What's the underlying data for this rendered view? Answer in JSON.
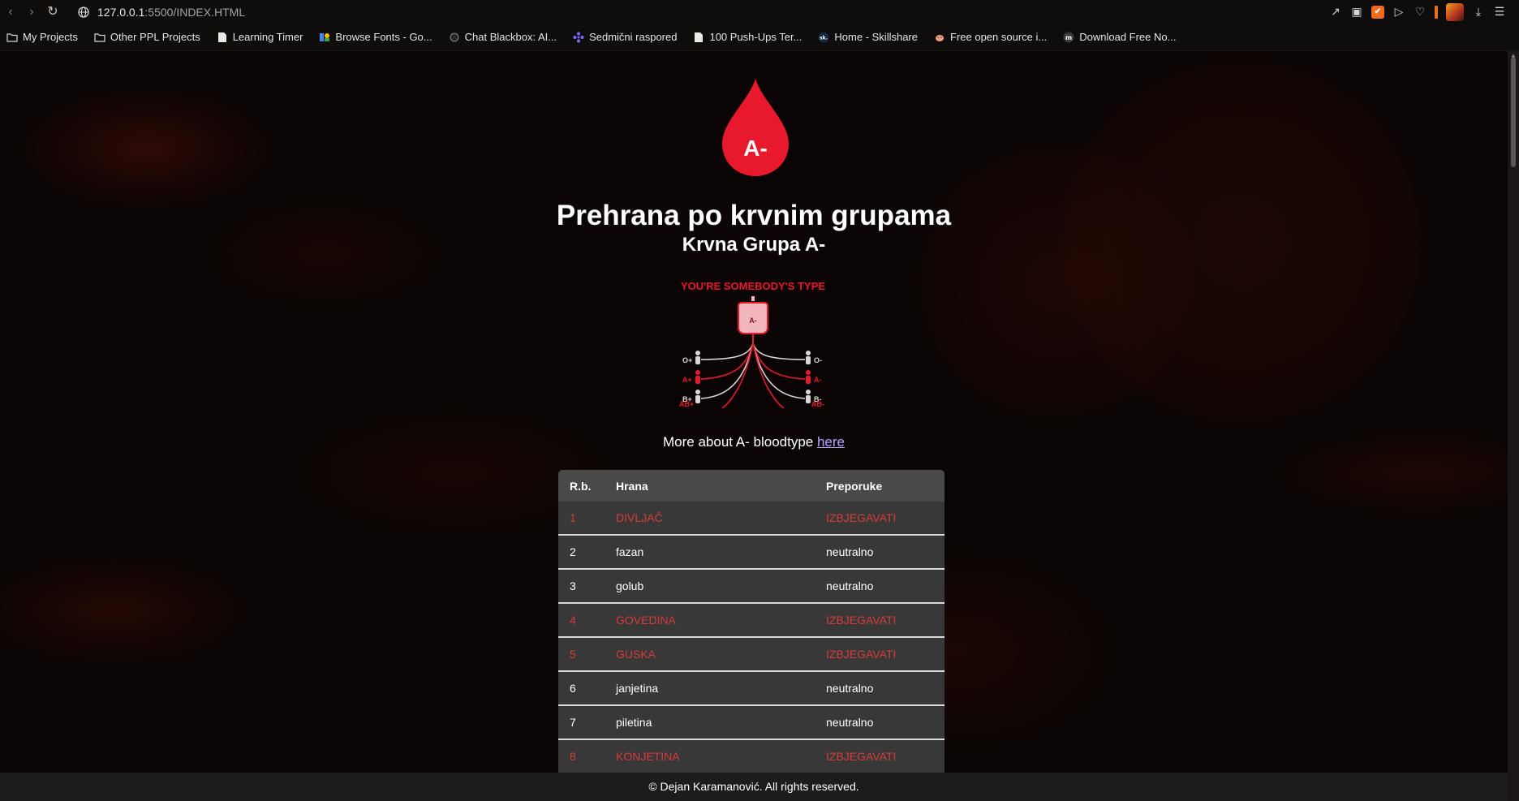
{
  "browser": {
    "url_host": "127.0.0.1",
    "url_rest": ":5500/INDEX.HTML"
  },
  "bookmarks": [
    {
      "label": "My Projects",
      "icon": "folder-icon"
    },
    {
      "label": "Other PPL Projects",
      "icon": "folder-icon"
    },
    {
      "label": "Learning Timer",
      "icon": "document-icon"
    },
    {
      "label": "Browse Fonts - Go...",
      "icon": "google-fonts-icon"
    },
    {
      "label": "Chat Blackbox: AI...",
      "icon": "blackbox-icon"
    },
    {
      "label": "Sedmični raspored",
      "icon": "asterisk-icon"
    },
    {
      "label": "100 Push-Ups Ter...",
      "icon": "document-icon"
    },
    {
      "label": "Home - Skillshare",
      "icon": "skillshare-icon"
    },
    {
      "label": "Free open source i...",
      "icon": "pig-icon"
    },
    {
      "label": "Download Free No...",
      "icon": "m-icon"
    }
  ],
  "page": {
    "drop_label": "A-",
    "title": "Prehrana po krvnim grupama",
    "subtitle": "Krvna Grupa A-",
    "graphic": {
      "tagline": "YOU'RE SOMEBODY'S TYPE",
      "bag_label": "A-",
      "left_types": [
        "O+",
        "A+",
        "B+",
        "AB+"
      ],
      "right_types": [
        "O-",
        "A-",
        "B-",
        "AB-"
      ]
    },
    "more_text": "More about A- bloodtype",
    "more_link": "here"
  },
  "table": {
    "headers": {
      "rb": "R.b.",
      "hrana": "Hrana",
      "preporuke": "Preporuke"
    },
    "rows": [
      {
        "rb": "1",
        "hrana": "DIVLJAČ",
        "preporuke": "IZBJEGAVATI"
      },
      {
        "rb": "2",
        "hrana": "fazan",
        "preporuke": "neutralno"
      },
      {
        "rb": "3",
        "hrana": "golub",
        "preporuke": "neutralno"
      },
      {
        "rb": "4",
        "hrana": "GOVEDINA",
        "preporuke": "IZBJEGAVATI"
      },
      {
        "rb": "5",
        "hrana": "GUSKA",
        "preporuke": "IZBJEGAVATI"
      },
      {
        "rb": "6",
        "hrana": "janjetina",
        "preporuke": "neutralno"
      },
      {
        "rb": "7",
        "hrana": "piletina",
        "preporuke": "neutralno"
      },
      {
        "rb": "8",
        "hrana": "KONJETINA",
        "preporuke": "IZBJEGAVATI"
      }
    ]
  },
  "footer": {
    "text": "© Dejan Karamanović. All rights reserved."
  },
  "colors": {
    "accent_red": "#e8192c",
    "avoid_red": "#d93b3b"
  }
}
